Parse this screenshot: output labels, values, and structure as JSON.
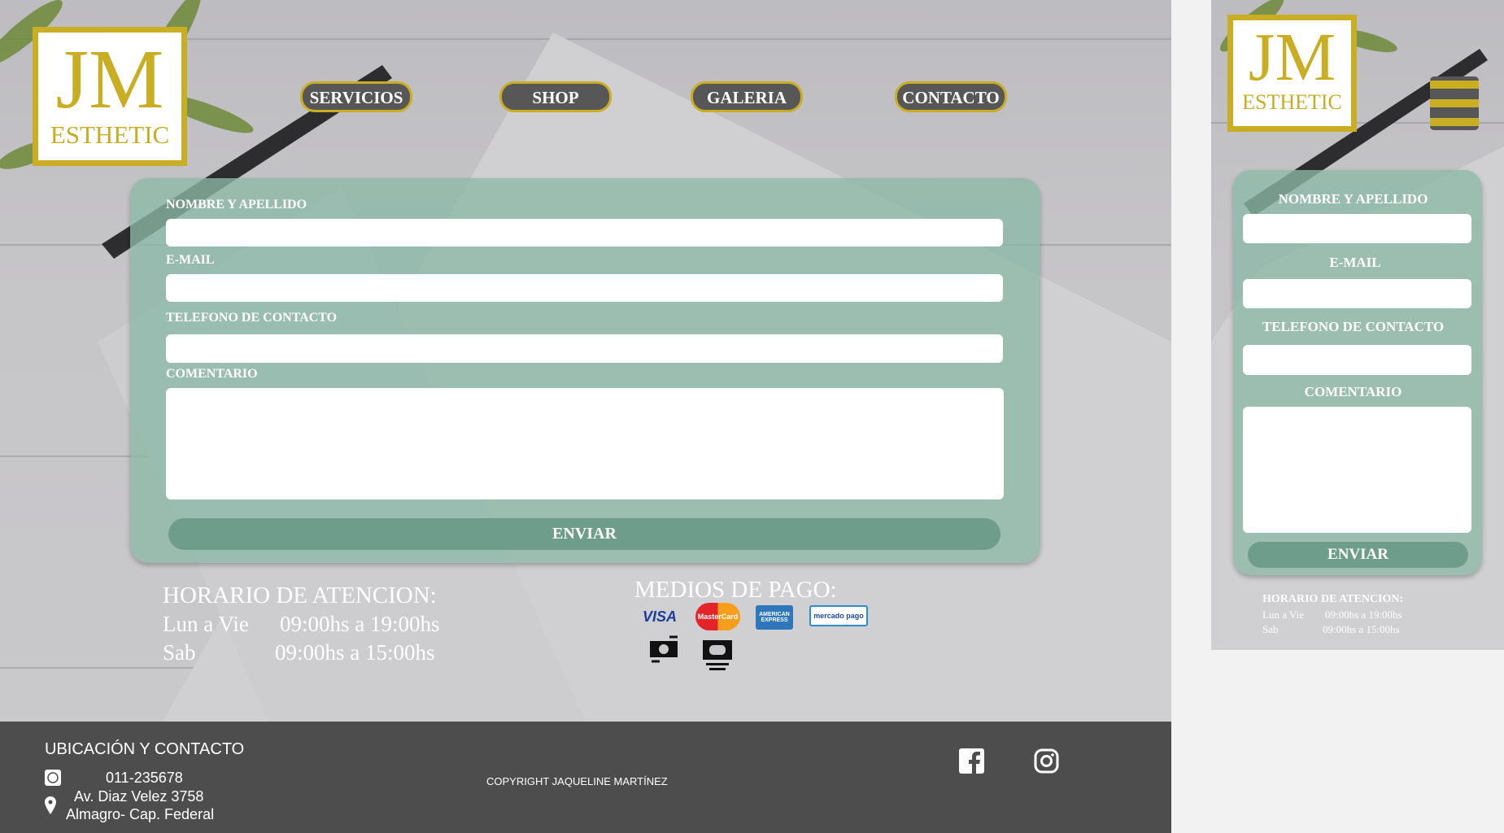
{
  "logo": {
    "top": "JM",
    "bottom": "ESTHETIC"
  },
  "nav": [
    {
      "label": "SERVICIOS"
    },
    {
      "label": "SHOP"
    },
    {
      "label": "GALERIA"
    },
    {
      "label": "CONTACTO"
    }
  ],
  "form": {
    "name_label": "NOMBRE Y APELLIDO",
    "name_value": "",
    "email_label": "E-MAIL",
    "email_value": "",
    "phone_label": "TELEFONO DE CONTACTO",
    "phone_value": "",
    "comment_label": "COMENTARIO",
    "comment_value": "",
    "submit_label": "ENVIAR"
  },
  "hours": {
    "title": "HORARIO DE ATENCION:",
    "rows": [
      {
        "days": "Lun a Vie",
        "time": "09:00hs a 19:00hs"
      },
      {
        "days": "Sab",
        "time": "09:00hs a 15:00hs"
      }
    ]
  },
  "payment": {
    "title": "MEDIOS DE PAGO:",
    "methods": [
      "VISA",
      "MasterCard",
      "AMERICAN EXPRESS",
      "mercado pago"
    ],
    "icons": [
      "cash-exchange-icon",
      "cash-icon"
    ]
  },
  "footer": {
    "title": "UBICACIÓN Y CONTACTO",
    "phone": "011-235678",
    "address1": "Av. Diaz Velez 3758",
    "address2": "Almagro- Cap. Federal",
    "copyright": "COPYRIGHT JAQUELINE MARTÍNEZ"
  },
  "colors": {
    "gold": "#c9ad22",
    "card": "#8cb9a8",
    "button": "#6e9e8b",
    "footer": "#4d4d4d",
    "nav": "#575757"
  }
}
